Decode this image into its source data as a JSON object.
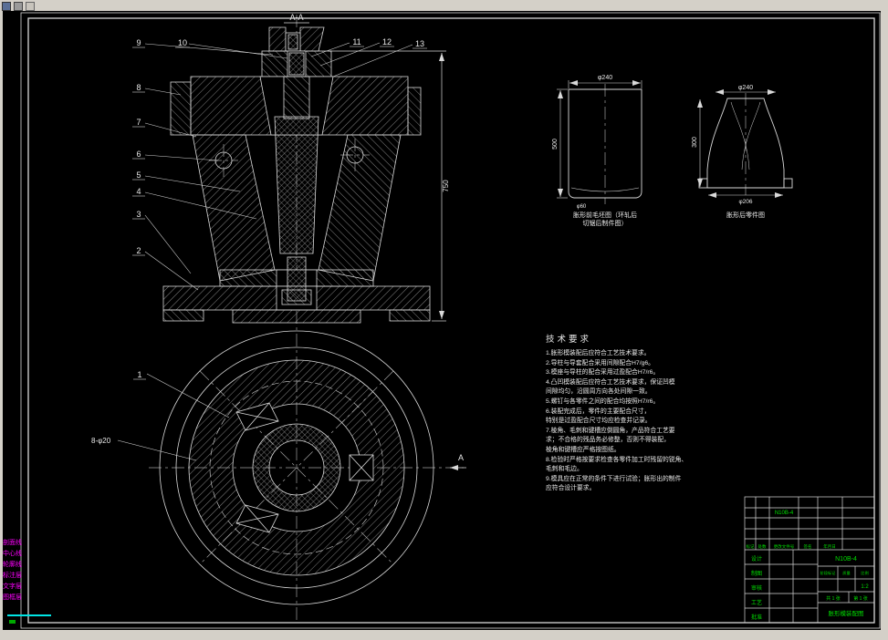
{
  "window": {
    "titlebar_icons": [
      "app-icon",
      "grid-icon",
      "document-icon"
    ]
  },
  "drawing": {
    "section_label": "A-A",
    "dim_overall_height": "750",
    "callouts": [
      "1",
      "2",
      "3",
      "4",
      "5",
      "6",
      "7",
      "8",
      "9",
      "10",
      "11",
      "12",
      "13"
    ],
    "plan": {
      "hole_note": "8-φ20",
      "section_arrow": "A"
    },
    "blank_view": {
      "dim_top": "φ240",
      "dim_side": "500",
      "dim_bottom": "φ60",
      "caption1": "胀形前毛坯图（环轧后",
      "caption2": "切锯后制件图）"
    },
    "part_view": {
      "dim_top": "φ240",
      "dim_side": "300",
      "dim_bottom": "φ206",
      "caption": "胀形后零件图"
    }
  },
  "tech": {
    "title": "技术要求",
    "lines": [
      "1.胀形模装配后应符合工艺技术要求。",
      "2.导柱与导套配合采用间隙配合H7/g6。",
      "3.模座与导柱的配合采用过盈配合H7/r6。",
      "4.凸凹模装配后应符合工艺技术要求，保证凹模",
      "   间隙均匀，沿圆周方向各处间隙一致。",
      "5.螺钉与各零件之间的配合均按照H7/r6。",
      "6.装配完成后，零件的主要配合尺寸，",
      "   特别是过盈配合尺寸均应检查并记录。",
      "7.棱角、毛刺和键槽应倒圆角，产品符合工艺要",
      "   求；不合格的残品务必修整，否则不得装配，",
      "   棱角和键槽应严格按图纸。",
      "8.检验时严格按要求检查各零件加工时残留的锐角、",
      "   毛刺和毛边。",
      "9.模具应在正常的条件下进行试验；胀形出的制件",
      "   应符合设计要求。"
    ]
  },
  "title_block": {
    "revision_header": [
      "标记",
      "处数",
      "更改文件号",
      "签名",
      "年月日"
    ],
    "code": "N10B-4",
    "signature_rows": [
      "设计",
      "制图",
      "审核",
      "工艺",
      "批准"
    ],
    "stage_label": "阶段标记",
    "weight_label": "质量",
    "scale_label": "比例",
    "scale_value": "1:2",
    "sheet_total": "共 1 张",
    "sheet_no": "第 1 张",
    "drawing_name": "胀形模装配图"
  },
  "side_labels": [
    "剖面线",
    "中心线",
    "轮廓线",
    "标注层",
    "文字层",
    "图框层"
  ]
}
